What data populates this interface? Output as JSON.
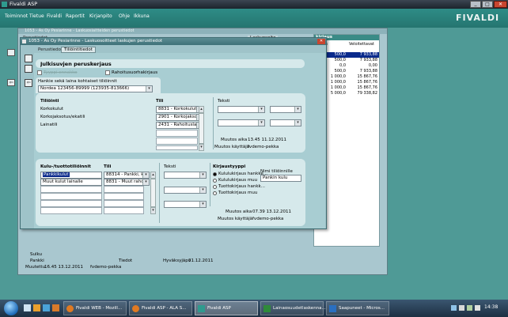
{
  "app": {
    "title": "Fivaldi ASP",
    "logo": "FIVALDI"
  },
  "menu": [
    "Toiminnot",
    "Tietue",
    "Fivaldi",
    "Raportit",
    "Kirjanpito",
    "Ohje",
    "Ikkuna"
  ],
  "bg_window": {
    "title": "1053 - As Oy Pesiarinne - Laskuosiaitteiden perustiedot",
    "tab_left": "Perustiedot",
    "tab_right": "Laskuosoite"
  },
  "right_panel": {
    "title": "kirjaus",
    "col1": "eriytys",
    "col2": "Veloitettavat",
    "rows": [
      [
        "500,0",
        "7 933,88"
      ],
      [
        "500,0",
        "7 933,88"
      ],
      [
        "0,0",
        "0,00"
      ],
      [
        "500,0",
        "7 933,88"
      ],
      [
        "1 000,0",
        "15 867,76"
      ],
      [
        "1 000,0",
        "15 867,76"
      ],
      [
        "1 000,0",
        "15 867,76"
      ],
      [
        "5 000,0",
        "79 338,82"
      ]
    ]
  },
  "bg_bottom": {
    "rows": [
      {
        "label": "Sulku",
        "value": ""
      },
      {
        "label": "Pankki",
        "value": ""
      },
      {
        "label": "Muutettu",
        "value": "16.45 13.12.2011"
      }
    ],
    "tiedot_label": "Tiedot",
    "hyvaksy_label": "Hyväksyjäpv",
    "hyvaksy_value": "31.12.2011",
    "user": "fvdemo-pekka"
  },
  "window": {
    "title": "1053 - As Oy Pesiarinne - Laskuosoitteet laskujen perustiedot",
    "tabs": [
      "Perustiedot",
      "Tiliöintitiedot"
    ]
  },
  "section": {
    "title": "Julkisuvjen peruskerjaus",
    "cb1_label": "Tyyppi ennakko",
    "cb2_label": "Rahoitusuorhakirjaus",
    "bank_label": "Hankie sekä laina kohtaiset tiliöinnit",
    "bank_value": "Nordea 123456-89999 (123935-813666)",
    "g1": {
      "h1": "Tiliöinti",
      "h2": "Tili",
      "h3": "Teksti",
      "rows": [
        {
          "label": "Korkokulut",
          "acct": "8831 - Korkokulut..."
        },
        {
          "label": "Korkojaksotus/ekatili",
          "acct": "2901 - Korkojakso..."
        },
        {
          "label": "Lainatili",
          "acct": "2431 - Rahoituslai..."
        }
      ],
      "muutos_aika_label": "Muutos aika",
      "muutos_aika": "13.45 11.12.2011",
      "muutos_kayttaja_label": "Muutos käyttäjä",
      "muutos_kayttaja": "fvdemo-pekka"
    },
    "g2": {
      "h1": "Kulu-/tuottotiliöinnit",
      "h2": "Tili",
      "h3": "Teksti",
      "h4": "Kirjaustyyppi",
      "h5": "Nimi tiliöinnille",
      "rows": [
        {
          "label": "Pankkikulut",
          "acct": "88314 - Pankki, k..."
        },
        {
          "label": "Muut kulut lainalle",
          "acct": "8831 - Muut rahoi..."
        }
      ],
      "radios": [
        "Kululukirjaus hankke...",
        "Kululukirjaus muu",
        "Tuottokirjaus hankk...",
        "Tuottokirjaus muu"
      ],
      "name_value": "Pankin kulu",
      "muutos_aika_label": "Muutos aika",
      "muutos_aika": "07.39 13.12.2011",
      "muutos_kayttaja_label": "Muutos käyttäjä",
      "muutos_kayttaja": "fvdemo-pekka"
    }
  },
  "taskbar": {
    "items": [
      "Fivaldi WEB - Mozill...",
      "Fivaldi ASP - ALA S...",
      "Fivaldi ASP",
      "Lainaosuudetlaskenna...",
      "Saapuneet - Micros..."
    ],
    "clock": "14:38"
  }
}
